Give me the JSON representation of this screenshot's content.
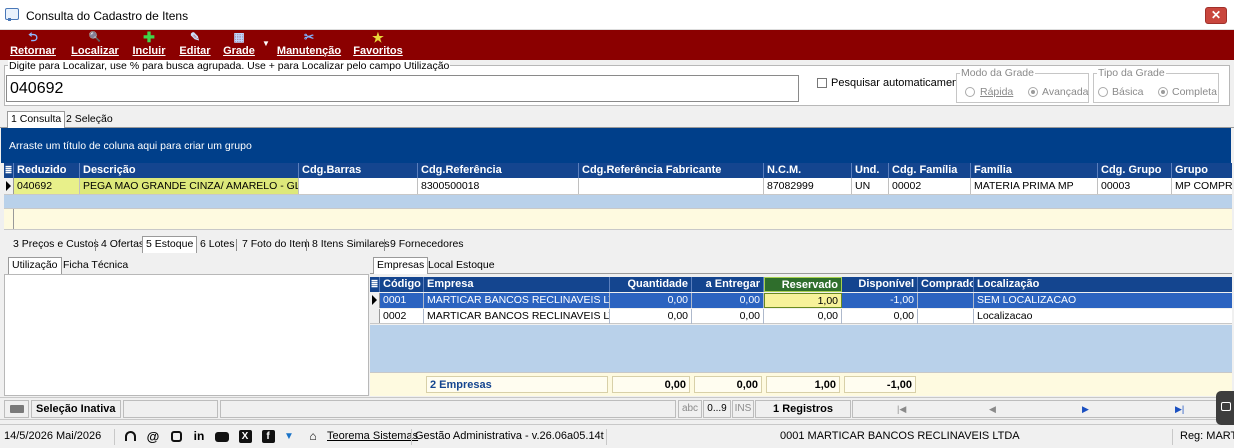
{
  "window": {
    "title": "Consulta do Cadastro de Itens",
    "close_glyph": "✕"
  },
  "toolbar": {
    "buttons": [
      {
        "label": "Retornar",
        "icon": "return-arrow-icon",
        "glyph": "⮌"
      },
      {
        "label": "Localizar",
        "icon": "search-icon",
        "glyph": "🔍"
      },
      {
        "label": "Incluir",
        "icon": "plus-icon",
        "glyph": "✚"
      },
      {
        "label": "Editar",
        "icon": "edit-icon",
        "glyph": "✎"
      },
      {
        "label": "Grade",
        "icon": "grid-icon",
        "glyph": "▦"
      },
      {
        "label": "Manutenção",
        "icon": "tools-icon",
        "glyph": "✂"
      },
      {
        "label": "Favoritos",
        "icon": "star-icon",
        "glyph": "★"
      }
    ],
    "dropdown_glyph": "▼"
  },
  "search": {
    "legend": "Digite para Localizar, use % para busca agrupada. Use + para Localizar pelo campo Utilização",
    "value": "040692",
    "auto_label": "Pesquisar automaticamente",
    "auto_checked": false
  },
  "grid_mode": {
    "legend": "Modo da Grade",
    "options": [
      "Rápida",
      "Avançada"
    ],
    "selected": "Avançada"
  },
  "grid_type": {
    "legend": "Tipo da Grade",
    "options": [
      "Básica",
      "Completa"
    ],
    "selected": "Completa"
  },
  "top_tabs": [
    "1 Consulta",
    "2 Seleção"
  ],
  "group_panel_text": "Arraste um título de coluna aqui para criar um grupo",
  "main_grid": {
    "columns": [
      "Reduzido",
      "Descrição",
      "Cdg.Barras",
      "Cdg.Referência",
      "Cdg.Referência Fabricante",
      "N.C.M.",
      "Und.",
      "Cdg. Família",
      "Família",
      "Cdg. Grupo",
      "Grupo"
    ],
    "rows": [
      [
        "040692",
        "PEGA MAO GRANDE CINZA/ AMARELO - GLOV",
        "",
        "8300500018",
        "",
        "87082999",
        "UN",
        "00002",
        "MATERIA PRIMA MP",
        "00003",
        "MP COMPRA"
      ]
    ]
  },
  "detail_tabs": [
    "3 Preços e Custos",
    "4 Ofertas",
    "5 Estoque",
    "6 Lotes",
    "7 Foto do Item",
    "8 Itens Similares",
    "9 Fornecedores"
  ],
  "left_tabs": [
    "Utilização",
    "Ficha Técnica"
  ],
  "right_tabs": [
    "Empresas",
    "Local Estoque"
  ],
  "stock_grid": {
    "columns": [
      "Código",
      "Empresa",
      "Quantidade",
      "a Entregar",
      "Reservado",
      "Disponível",
      "Comprado",
      "Localização"
    ],
    "rows": [
      [
        "0001",
        "MARTICAR BANCOS RECLINAVEIS LTD",
        "0,00",
        "0,00",
        "1,00",
        "-1,00",
        "",
        "SEM LOCALIZACAO"
      ],
      [
        "0002",
        "MARTICAR BANCOS RECLINAVEIS LTD",
        "0,00",
        "0,00",
        "0,00",
        "0,00",
        "",
        "Localizacao"
      ]
    ],
    "footer": {
      "count": "2 Empresas",
      "quantidade": "0,00",
      "a_entregar": "0,00",
      "reservado": "1,00",
      "disponivel": "-1,00"
    }
  },
  "navbar": {
    "selection": "Seleção Inativa",
    "abc": "abc",
    "digits": "0...9",
    "ins": "INS",
    "records": "1 Registros",
    "first": "|◀",
    "prev": "◀",
    "next": "▶",
    "last": "▶|"
  },
  "statusbar": {
    "date": "14/5/2026 Mai/2026",
    "company_link": "Teorema Sistemas",
    "app_version": "Gestão Administrativa - v.26.06a05.14t",
    "company": "0001 MARTICAR BANCOS RECLINAVEIS LTDA",
    "reg": "Reg: MARTI",
    "icons": [
      "headset-icon",
      "at-icon",
      "instagram-icon",
      "linkedin-icon",
      "youtube-icon",
      "x-icon",
      "facebook-icon",
      "funnel-icon",
      "school-icon"
    ]
  },
  "colors": {
    "toolbar": "#8b0000",
    "grid_header": "#14458f",
    "selection": "#2b63c0",
    "footer": "#fefae0",
    "group_panel": "#003f8a"
  }
}
